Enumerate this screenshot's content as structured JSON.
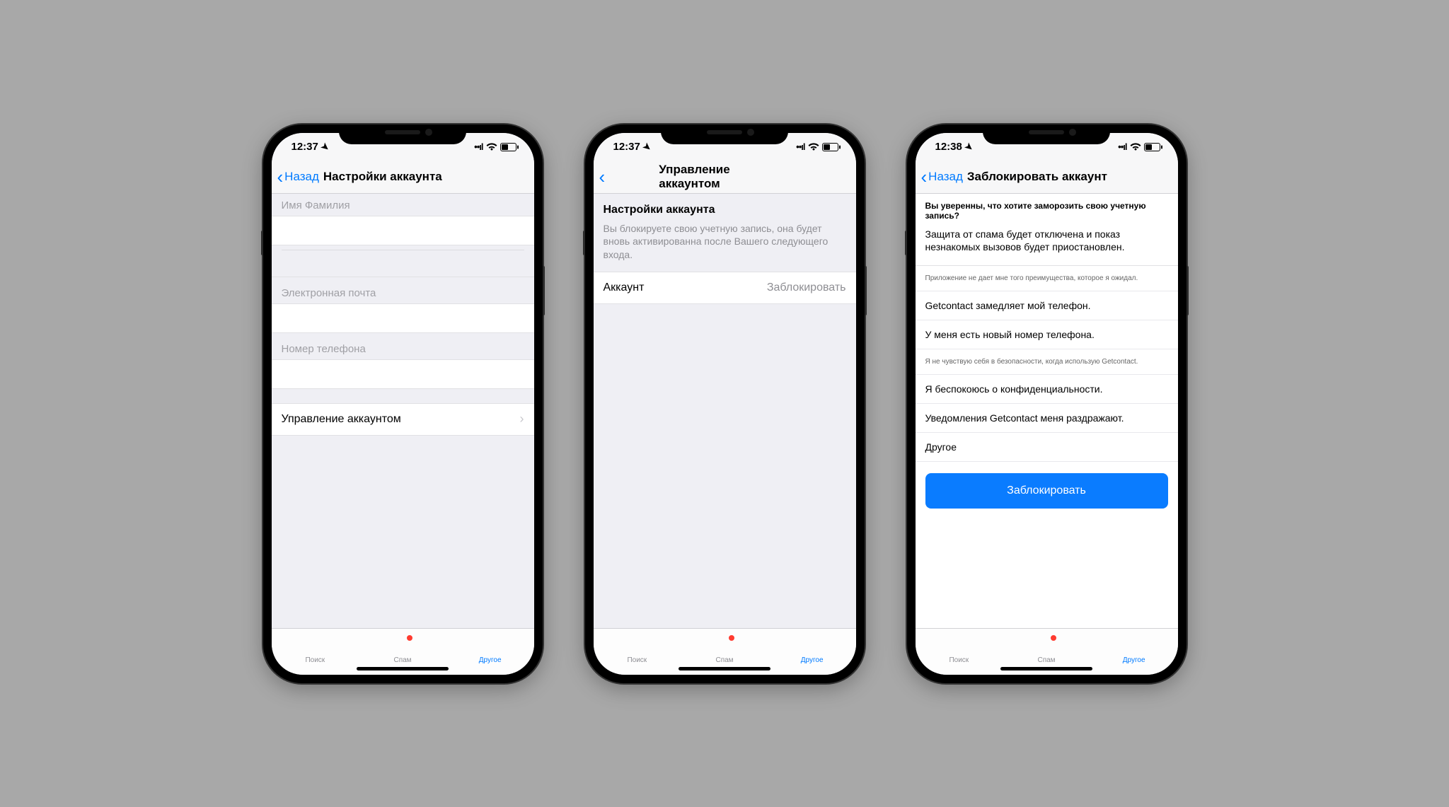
{
  "screens": [
    {
      "status": {
        "time": "12:37",
        "location_arrow": "➤"
      },
      "nav": {
        "back_label": "Назад",
        "title": "Настройки аккаунта"
      },
      "fields": {
        "name_label": "Имя Фамилия",
        "email_label": "Электронная почта",
        "phone_label": "Номер телефона"
      },
      "manage_row": "Управление аккаунтом"
    },
    {
      "status": {
        "time": "12:37",
        "location_arrow": "➤"
      },
      "nav": {
        "title": "Управление аккаунтом"
      },
      "section": {
        "heading": "Настройки аккаунта",
        "desc": "Вы блокируете свою учетную запись, она будет вновь активированна после Вашего следующего входа."
      },
      "row": {
        "label": "Аккаунт",
        "value": "Заблокировать"
      }
    },
    {
      "status": {
        "time": "12:38",
        "location_arrow": "➤"
      },
      "nav": {
        "back_label": "Назад",
        "title": "Заблокировать аккаунт"
      },
      "question": "Вы уверенны, что хотите заморозить свою учетную запись?",
      "info": "Защита от спама будет отключена и показ незнакомых вызовов будет приостановлен.",
      "reasons": [
        "Приложение не дает мне того преимущества, которое я ожидал.",
        "Getcontact замедляет мой телефон.",
        "У меня есть новый номер телефона.",
        "Я не чувствую себя в безопасности, когда использую Getcontact.",
        "Я беспокоюсь о конфиденциальности.",
        "Уведомления Getcontact меня раздражают.",
        "Другое"
      ],
      "button": "Заблокировать"
    }
  ],
  "tabs": {
    "search": "Поиск",
    "spam": "Спам",
    "other": "Другое"
  },
  "status_icons": {
    "wifi": "ᯤ",
    "battery": "▢"
  }
}
